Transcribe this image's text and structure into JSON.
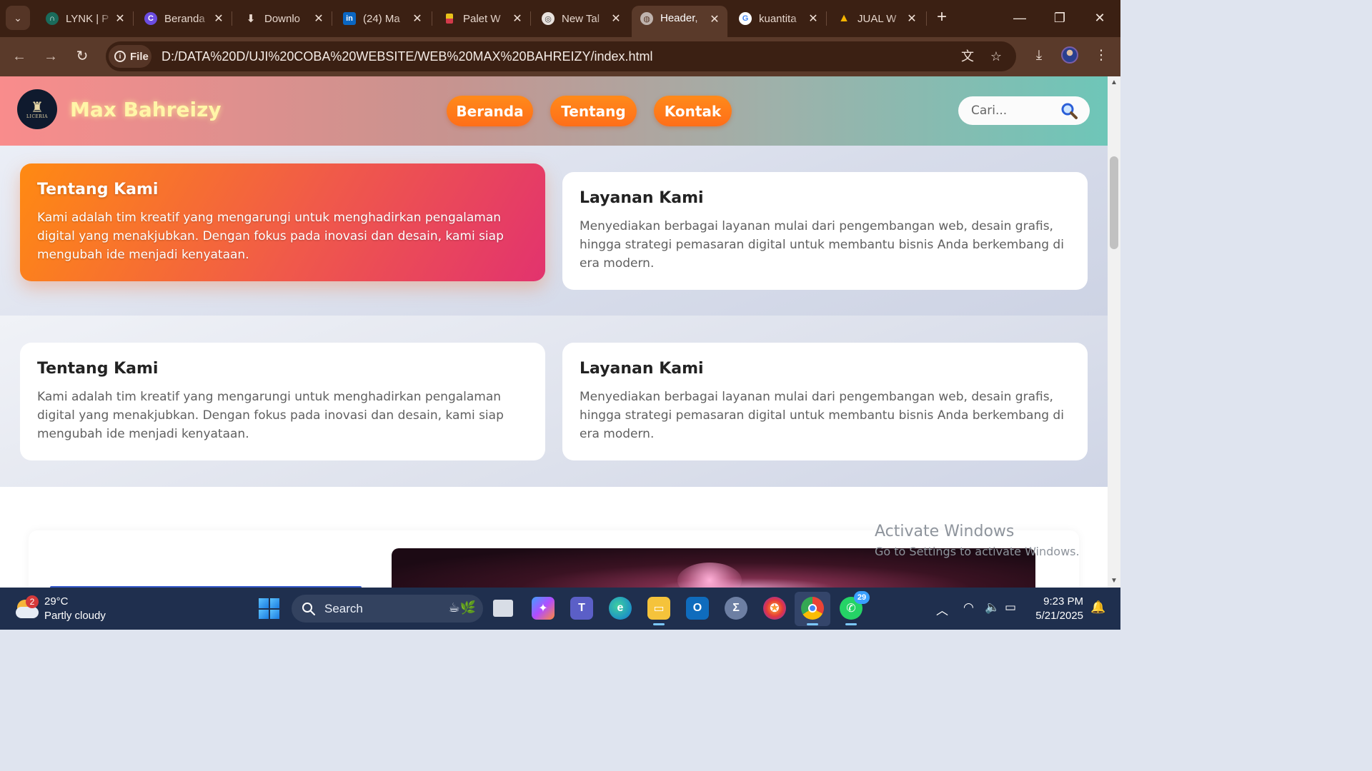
{
  "browser": {
    "tabs": [
      {
        "title": "LYNK | P",
        "favicon_color": "#1a6b5b",
        "favicon_glyph": "∩"
      },
      {
        "title": "Beranda",
        "favicon_color": "#6b4ce0",
        "favicon_glyph": "C"
      },
      {
        "title": "Downlo",
        "favicon_color": "transparent",
        "favicon_glyph": "⬇"
      },
      {
        "title": "(24) Ma",
        "favicon_color": "#0a66c2",
        "favicon_glyph": "in"
      },
      {
        "title": "Palet W",
        "favicon_color": "#e8c21a",
        "favicon_glyph": "▮"
      },
      {
        "title": "New Tal",
        "favicon_color": "#777777",
        "favicon_glyph": "◎"
      },
      {
        "title": "Header,",
        "favicon_color": "#8a8a8a",
        "favicon_glyph": "◍"
      },
      {
        "title": "kuantita",
        "favicon_color": "#ffffff",
        "favicon_glyph": "G"
      },
      {
        "title": "JUAL W",
        "favicon_color": "transparent",
        "favicon_glyph": "▲"
      }
    ],
    "active_tab_index": 6,
    "file_chip": "File",
    "url": "D:/DATA%20D/UJI%20COBA%20WEBSITE/WEB%20MAX%20BAHREIZY/index.html"
  },
  "site": {
    "logo_text": "LICERIA",
    "brand": "Max Bahreizy",
    "nav": [
      "Beranda",
      "Tentang",
      "Kontak"
    ],
    "search_placeholder": "Cari...",
    "section1": [
      {
        "title": "Tentang Kami",
        "text": "Kami adalah tim kreatif yang mengarungi untuk menghadirkan pengalaman digital yang menakjubkan. Dengan fokus pada inovasi dan desain, kami siap mengubah ide menjadi kenyataan.",
        "highlighted": true
      },
      {
        "title": "Layanan Kami",
        "text": "Menyediakan berbagai layanan mulai dari pengembangan web, desain grafis, hingga strategi pemasaran digital untuk membantu bisnis Anda berkembang di era modern.",
        "highlighted": false
      }
    ],
    "section2": [
      {
        "title": "Tentang Kami",
        "text": "Kami adalah tim kreatif yang mengarungi untuk menghadirkan pengalaman digital yang menakjubkan. Dengan fokus pada inovasi dan desain, kami siap mengubah ide menjadi kenyataan."
      },
      {
        "title": "Layanan Kami",
        "text": "Menyediakan berbagai layanan mulai dari pengembangan web, desain grafis, hingga strategi pemasaran digital untuk membantu bisnis Anda berkembang di era modern."
      }
    ]
  },
  "watermark": {
    "line1": "Activate Windows",
    "line2": "Go to Settings to activate Windows."
  },
  "taskbar": {
    "weather_badge": "2",
    "temperature": "29°C",
    "condition": "Partly cloudy",
    "search_label": "Search",
    "whatsapp_badge": "29",
    "time": "9:23 PM",
    "date": "5/21/2025"
  },
  "colors": {
    "chrome_dark": "#3b2013",
    "chrome_toolbar": "#5a3a2a",
    "nav_pill": "#ff7a1a",
    "brand_text": "#fff6a8",
    "taskbar": "#1f2f4e"
  }
}
